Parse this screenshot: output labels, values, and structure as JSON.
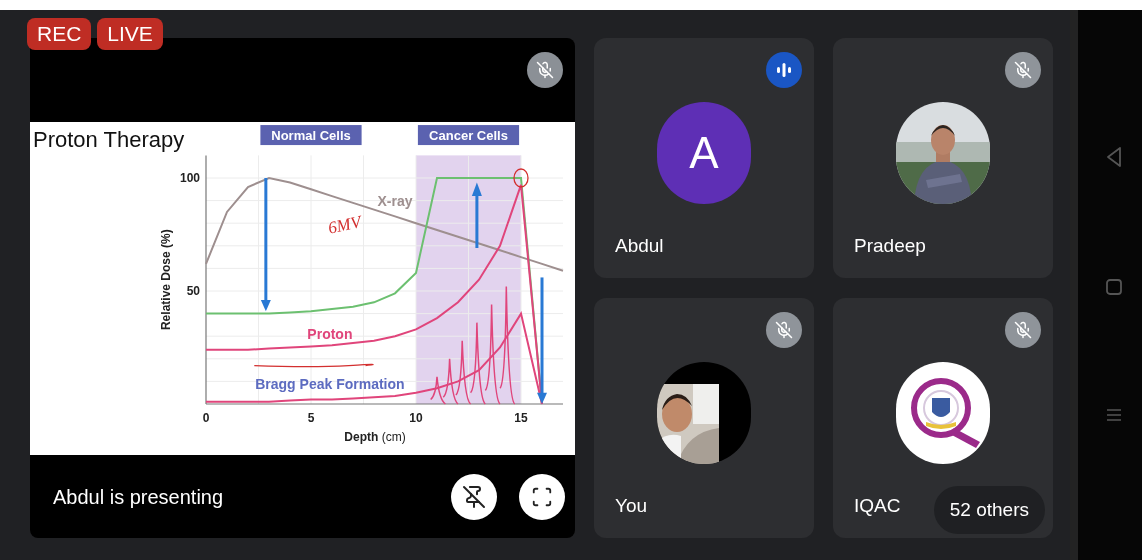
{
  "badges": [
    {
      "label": "REC"
    },
    {
      "label": "LIVE"
    }
  ],
  "presentation": {
    "muted": true,
    "caption": "Abdul is presenting",
    "slide": {
      "chart_data": {
        "type": "line",
        "title": "Proton Therapy",
        "xlabel": "**Depth** (cm)",
        "ylabel": "Relative Dose (%)",
        "x": [
          0,
          1,
          2,
          3,
          4,
          5,
          6,
          7,
          8,
          9,
          10,
          11,
          12,
          13,
          14,
          15,
          16,
          17
        ],
        "series": [
          {
            "name": "X-ray",
            "color": "#9e8f8f",
            "values": [
              62,
              85,
              96,
              100,
              98,
              95,
              92,
              89,
              86,
              83,
              80,
              77,
              74,
              71,
              68,
              65,
              62,
              59
            ]
          },
          {
            "color": "#6cc070",
            "values": [
              40,
              40,
              40,
              40,
              40.5,
              41,
              42,
              43,
              45,
              49,
              58,
              100,
              100,
              100,
              100,
              100,
              0,
              null
            ]
          },
          {
            "name": "Proton",
            "color": "#e0457b",
            "values": [
              24,
              24,
              24,
              24.5,
              25,
              25.5,
              26,
              27,
              28,
              30,
              33,
              38,
              45,
              55,
              70,
              97,
              0,
              null
            ]
          },
          {
            "color": "#e0457b",
            "values": [
              1,
              1,
              1,
              1,
              1.5,
              2,
              2,
              2.5,
              3,
              3.5,
              5,
              7,
              10,
              15,
              25,
              40,
              0,
              null
            ]
          }
        ],
        "xlim": [
          0,
          17
        ],
        "ylim": [
          0,
          110
        ],
        "xticks": [
          0,
          5,
          10,
          15
        ],
        "yticks": [
          50,
          100
        ],
        "grid": true,
        "annotations": [
          "Normal Cells",
          "Cancer Cells",
          "6MV",
          "Bragg Peak Formation"
        ]
      }
    }
  },
  "participants": [
    {
      "name": "Abdul",
      "kind": "letter",
      "letter": "A",
      "color": "#5e2fb5",
      "speaking": true,
      "muted": false
    },
    {
      "name": "Pradeep",
      "speaking": false,
      "muted": true
    },
    {
      "name": "You",
      "kind": "camera",
      "speaking": false,
      "muted": true
    },
    {
      "name": "IQAC",
      "kind": "logo",
      "speaking": false,
      "muted": true,
      "others": "52 others"
    }
  ]
}
